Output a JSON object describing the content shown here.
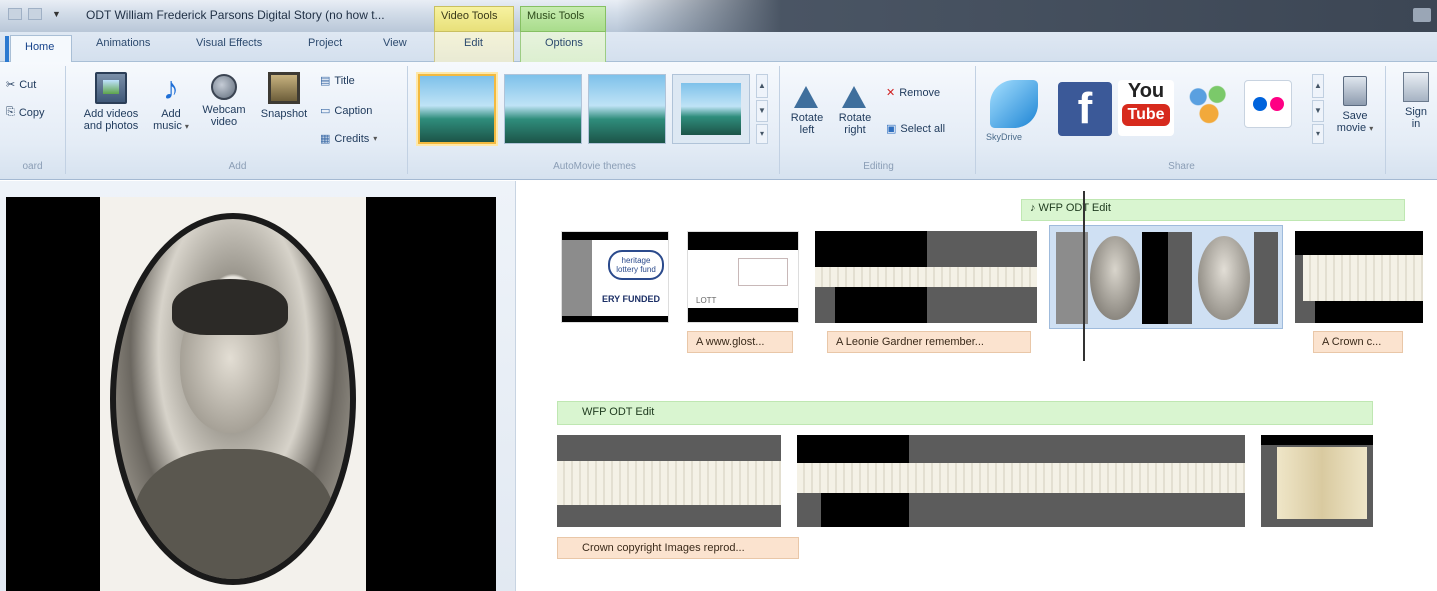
{
  "window": {
    "title": "ODT William Frederick Parsons Digital Story (no how t...",
    "contextual_tabs": [
      "Video Tools",
      "Music Tools"
    ]
  },
  "tabs": [
    {
      "label": "Home",
      "active": true
    },
    {
      "label": "Animations"
    },
    {
      "label": "Visual Effects"
    },
    {
      "label": "Project"
    },
    {
      "label": "View"
    },
    {
      "label": "Edit"
    },
    {
      "label": "Options"
    }
  ],
  "ribbon": {
    "clipboard": {
      "cut": "Cut",
      "copy": "Copy",
      "group_label": "oard"
    },
    "add": {
      "add_videos_l1": "Add videos",
      "add_videos_l2": "and photos",
      "add_music_l1": "Add",
      "add_music_l2": "music",
      "webcam_l1": "Webcam",
      "webcam_l2": "video",
      "snapshot": "Snapshot",
      "title": "Title",
      "caption": "Caption",
      "credits": "Credits",
      "group_label": "Add"
    },
    "themes": {
      "group_label": "AutoMovie themes"
    },
    "editing": {
      "rotate_left_l1": "Rotate",
      "rotate_left_l2": "left",
      "rotate_right_l1": "Rotate",
      "rotate_right_l2": "right",
      "remove": "Remove",
      "select_all": "Select all",
      "group_label": "Editing"
    },
    "share": {
      "skydrive": "SkyDrive",
      "youtube_top": "You",
      "youtube_bottom": "Tube",
      "save_movie_l1": "Save",
      "save_movie_l2": "movie",
      "sign_in_l1": "Sign",
      "sign_in_l2": "in",
      "group_label": "Share"
    }
  },
  "storyboard": {
    "row1_music": "♪ WFP ODT Edit",
    "row1_captions": [
      "A www.glost...",
      "A Leonie Gardner remember...",
      "A Crown c..."
    ],
    "clip1_text_a": "heritage lottery fund",
    "clip1_text_b": "ERY FUNDED",
    "clip2_text_a": "LOTT",
    "row2_music": "WFP ODT Edit",
    "row2_caption": "Crown copyright Images reprod..."
  },
  "colors": {
    "ribbon_bg": "#e4ecf6",
    "video_tools": "#e8e07a",
    "music_tools": "#a9dc8c",
    "music_bar": "#d9f5d0",
    "caption_bar": "#fbe3cf"
  }
}
